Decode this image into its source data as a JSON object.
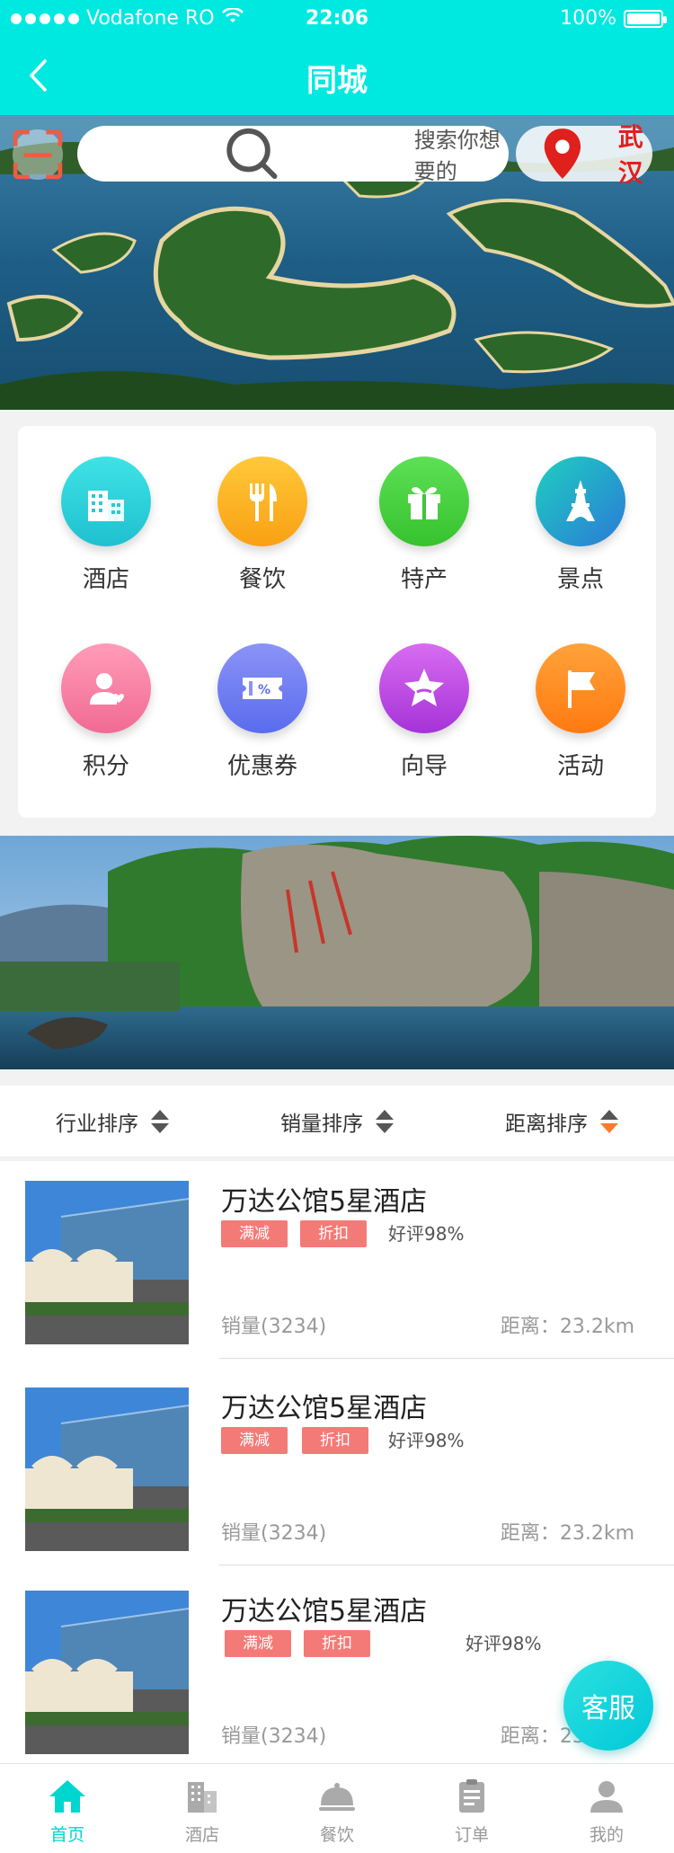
{
  "status": {
    "carrier": "Vodafone RO",
    "time": "22:06",
    "battery": "100%"
  },
  "nav": {
    "title": "同城"
  },
  "search": {
    "placeholder": "搜索你想要的",
    "city": "武汉"
  },
  "categories": [
    {
      "label": "酒店",
      "icon": "hotel-icon",
      "color": "#2cd4d8"
    },
    {
      "label": "餐饮",
      "icon": "dining-icon",
      "color": "#fdb017"
    },
    {
      "label": "特产",
      "icon": "gift-icon",
      "color": "#46d240"
    },
    {
      "label": "景点",
      "icon": "tower-icon",
      "color": "#1e9fe0"
    },
    {
      "label": "积分",
      "icon": "points-icon",
      "color": "#f67fa3"
    },
    {
      "label": "优惠券",
      "icon": "coupon-icon",
      "color": "#6a7cf2"
    },
    {
      "label": "向导",
      "icon": "guide-star-icon",
      "color": "#c04ae6"
    },
    {
      "label": "活动",
      "icon": "flag-icon",
      "color": "#ff8b1a"
    }
  ],
  "sort": {
    "industry": "行业排序",
    "sales": "销量排序",
    "distance": "距离排序",
    "active_color": "#ff7a2a"
  },
  "items": [
    {
      "title": "万达公馆5星酒店",
      "tags": [
        "满减",
        "折扣"
      ],
      "rating": "好评98%",
      "sales": "销量(3234)",
      "distance": "距离：23.2km"
    },
    {
      "title": "万达公馆5星酒店",
      "tags": [
        "满减",
        "折扣"
      ],
      "rating": "好评98%",
      "sales": "销量(3234)",
      "distance": "距离：23.2km"
    },
    {
      "title": "万达公馆5星酒店",
      "tags": [
        "满减",
        "折扣"
      ],
      "rating": "好评98%",
      "sales": "销量(3234)",
      "distance": "距离：23.2km"
    }
  ],
  "float_button": {
    "label": "客服"
  },
  "tabs": [
    {
      "label": "首页",
      "icon": "home-icon"
    },
    {
      "label": "酒店",
      "icon": "building-icon"
    },
    {
      "label": "餐饮",
      "icon": "cloche-icon"
    },
    {
      "label": "订单",
      "icon": "clipboard-icon"
    },
    {
      "label": "我的",
      "icon": "user-icon"
    }
  ],
  "colors": {
    "primary": "#00e9e1",
    "tag": "#f47a77",
    "tab_active": "#00d6d0"
  }
}
